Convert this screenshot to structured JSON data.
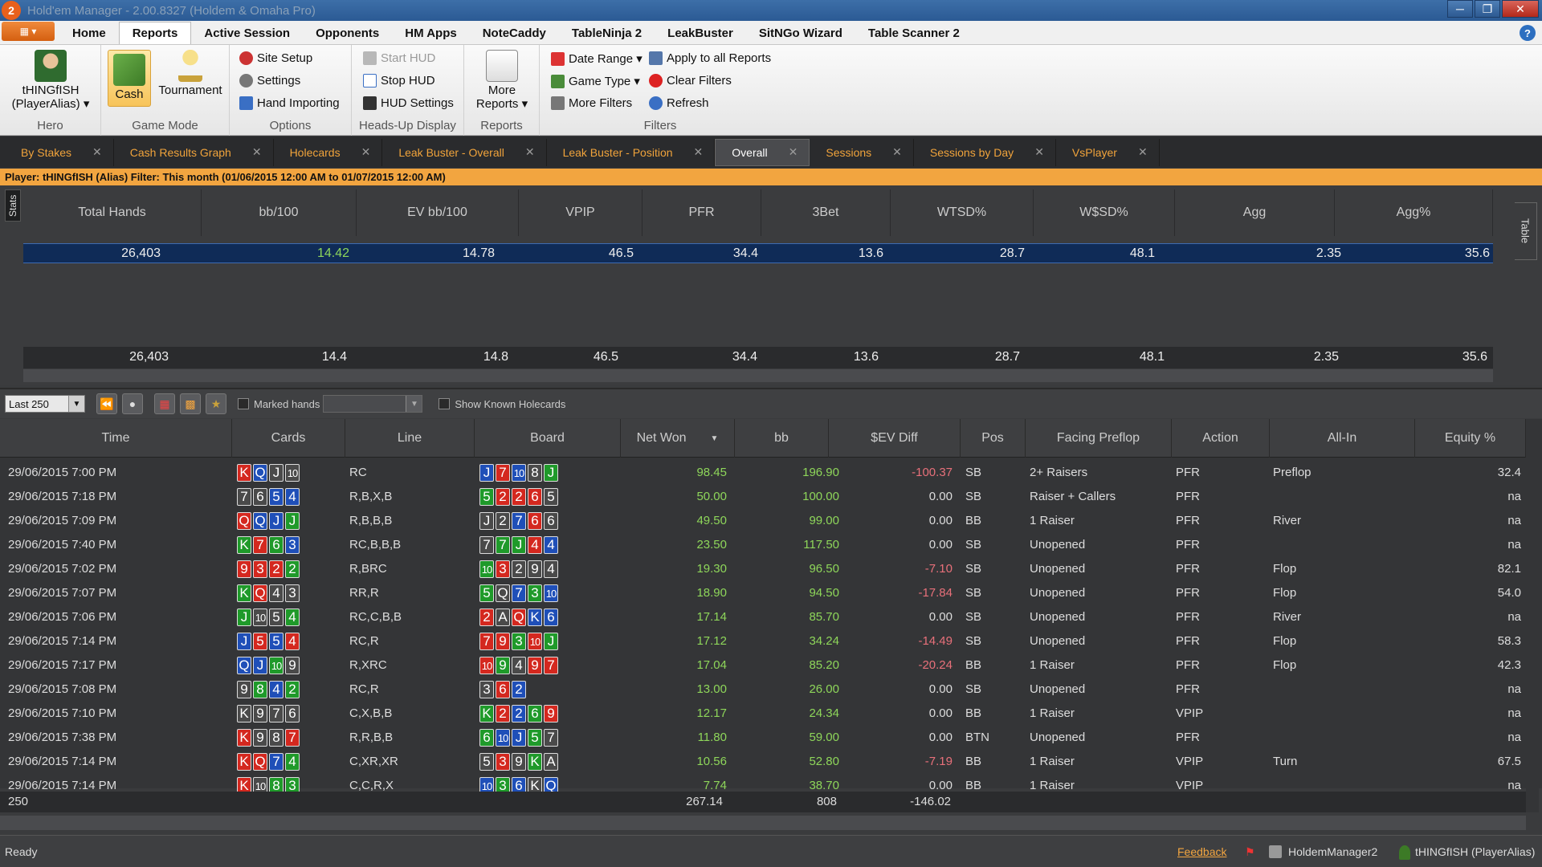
{
  "window": {
    "title": "Hold'em Manager - 2.00.8327 (Holdem & Omaha Pro)",
    "logo": "2",
    "controls": [
      "minimize-icon",
      "maximize-icon",
      "close-icon"
    ]
  },
  "menu": {
    "tabs": [
      "Home",
      "Reports",
      "Active Session",
      "Opponents",
      "HM Apps",
      "NoteCaddy",
      "TableNinja 2",
      "LeakBuster",
      "SitNGo Wizard",
      "Table Scanner 2"
    ],
    "active": "Reports",
    "help": "?"
  },
  "ribbon": {
    "hero": {
      "label": "tHINGfISH (PlayerAlias) ▾",
      "caption": "Hero"
    },
    "game_mode": {
      "cash": "Cash",
      "tournament": "Tournament",
      "caption": "Game Mode"
    },
    "options": {
      "site_setup": "Site Setup",
      "settings": "Settings",
      "hand_importing": "Hand Importing",
      "caption": "Options"
    },
    "hud": {
      "start": "Start HUD",
      "stop": "Stop HUD",
      "settings": "HUD Settings",
      "caption": "Heads-Up Display"
    },
    "reports": {
      "more": "More Reports ▾",
      "caption": "Reports"
    },
    "filters": {
      "date_range": "Date Range ▾",
      "game_type": "Game Type ▾",
      "more_filters": "More Filters",
      "apply_all": "Apply to all Reports",
      "clear": "Clear Filters",
      "refresh": "Refresh",
      "caption": "Filters"
    }
  },
  "doc_tabs": [
    "By Stakes",
    "Cash Results Graph",
    "Holecards",
    "Leak Buster - Overall",
    "Leak Buster - Position",
    "Overall",
    "Sessions",
    "Sessions by Day",
    "VsPlayer"
  ],
  "doc_tabs_active": "Overall",
  "filter_bar": "Player: tHINGfISH (Alias)   Filter: This month (01/06/2015 12:00 AM to 01/07/2015 12:00 AM)",
  "stats": {
    "side_tab": "Stats",
    "table_tab": "Table",
    "headers": [
      "Total Hands",
      "bb/100",
      "EV bb/100",
      "VPIP",
      "PFR",
      "3Bet",
      "WTSD%",
      "W$SD%",
      "Agg",
      "Agg%"
    ],
    "row": [
      "26,403",
      "14.42",
      "14.78",
      "46.5",
      "34.4",
      "13.6",
      "28.7",
      "48.1",
      "2.35",
      "35.6"
    ],
    "totals": [
      "26,403",
      "14.4",
      "14.8",
      "46.5",
      "34.4",
      "13.6",
      "28.7",
      "48.1",
      "2.35",
      "35.6"
    ]
  },
  "hands_toolbar": {
    "last_select": "Last 250",
    "marked_hands": "Marked hands",
    "show_known": "Show Known Holecards"
  },
  "hands": {
    "headers": [
      "Time",
      "Cards",
      "Line",
      "Board",
      "Net Won",
      "bb",
      "$EV Diff",
      "Pos",
      "Facing Preflop",
      "Action",
      "All-In",
      "Equity %"
    ],
    "sort_indicator": "▼",
    "rows": [
      {
        "time": "29/06/2015 7:00 PM",
        "cards": [
          [
            "K",
            "h"
          ],
          [
            "Q",
            "d"
          ],
          [
            "J",
            "s"
          ],
          [
            "10",
            "s"
          ]
        ],
        "line": "RC",
        "board": [
          [
            "J",
            "d"
          ],
          [
            "7",
            "h"
          ],
          [
            "10",
            "d"
          ],
          [
            "8",
            "s"
          ],
          [
            "J",
            "c"
          ]
        ],
        "net": "98.45",
        "bb": "196.90",
        "ev": "-100.37",
        "pos": "SB",
        "facing": "2+ Raisers",
        "action": "PFR",
        "allin": "Preflop",
        "equity": "32.4"
      },
      {
        "time": "29/06/2015 7:18 PM",
        "cards": [
          [
            "7",
            "s"
          ],
          [
            "6",
            "s"
          ],
          [
            "5",
            "d"
          ],
          [
            "4",
            "d"
          ]
        ],
        "line": "R,B,X,B",
        "board": [
          [
            "5",
            "c"
          ],
          [
            "2",
            "h"
          ],
          [
            "2",
            "h"
          ],
          [
            "6",
            "h"
          ],
          [
            "5",
            "s"
          ]
        ],
        "net": "50.00",
        "bb": "100.00",
        "ev": "0.00",
        "pos": "SB",
        "facing": "Raiser + Callers",
        "action": "PFR",
        "allin": "",
        "equity": "na"
      },
      {
        "time": "29/06/2015 7:09 PM",
        "cards": [
          [
            "Q",
            "h"
          ],
          [
            "Q",
            "d"
          ],
          [
            "J",
            "d"
          ],
          [
            "J",
            "c"
          ]
        ],
        "line": "R,B,B,B",
        "board": [
          [
            "J",
            "s"
          ],
          [
            "2",
            "s"
          ],
          [
            "7",
            "d"
          ],
          [
            "6",
            "h"
          ],
          [
            "6",
            "s"
          ]
        ],
        "net": "49.50",
        "bb": "99.00",
        "ev": "0.00",
        "pos": "BB",
        "facing": "1 Raiser",
        "action": "PFR",
        "allin": "River",
        "equity": "na"
      },
      {
        "time": "29/06/2015 7:40 PM",
        "cards": [
          [
            "K",
            "c"
          ],
          [
            "7",
            "h"
          ],
          [
            "6",
            "c"
          ],
          [
            "3",
            "d"
          ]
        ],
        "line": "RC,B,B,B",
        "board": [
          [
            "7",
            "s"
          ],
          [
            "7",
            "c"
          ],
          [
            "J",
            "c"
          ],
          [
            "4",
            "h"
          ],
          [
            "4",
            "d"
          ]
        ],
        "net": "23.50",
        "bb": "117.50",
        "ev": "0.00",
        "pos": "SB",
        "facing": "Unopened",
        "action": "PFR",
        "allin": "",
        "equity": "na"
      },
      {
        "time": "29/06/2015 7:02 PM",
        "cards": [
          [
            "9",
            "h"
          ],
          [
            "3",
            "h"
          ],
          [
            "2",
            "h"
          ],
          [
            "2",
            "c"
          ]
        ],
        "line": "R,BRC",
        "board": [
          [
            "10",
            "c"
          ],
          [
            "3",
            "h"
          ],
          [
            "2",
            "s"
          ],
          [
            "9",
            "s"
          ],
          [
            "4",
            "s"
          ]
        ],
        "net": "19.30",
        "bb": "96.50",
        "ev": "-7.10",
        "pos": "SB",
        "facing": "Unopened",
        "action": "PFR",
        "allin": "Flop",
        "equity": "82.1"
      },
      {
        "time": "29/06/2015 7:07 PM",
        "cards": [
          [
            "K",
            "c"
          ],
          [
            "Q",
            "h"
          ],
          [
            "4",
            "s"
          ],
          [
            "3",
            "s"
          ]
        ],
        "line": "RR,R",
        "board": [
          [
            "5",
            "c"
          ],
          [
            "Q",
            "s"
          ],
          [
            "7",
            "d"
          ],
          [
            "3",
            "c"
          ],
          [
            "10",
            "d"
          ]
        ],
        "net": "18.90",
        "bb": "94.50",
        "ev": "-17.84",
        "pos": "SB",
        "facing": "Unopened",
        "action": "PFR",
        "allin": "Flop",
        "equity": "54.0"
      },
      {
        "time": "29/06/2015 7:06 PM",
        "cards": [
          [
            "J",
            "c"
          ],
          [
            "10",
            "s"
          ],
          [
            "5",
            "s"
          ],
          [
            "4",
            "c"
          ]
        ],
        "line": "RC,C,B,B",
        "board": [
          [
            "2",
            "h"
          ],
          [
            "A",
            "s"
          ],
          [
            "Q",
            "h"
          ],
          [
            "K",
            "d"
          ],
          [
            "6",
            "d"
          ]
        ],
        "net": "17.14",
        "bb": "85.70",
        "ev": "0.00",
        "pos": "SB",
        "facing": "Unopened",
        "action": "PFR",
        "allin": "River",
        "equity": "na"
      },
      {
        "time": "29/06/2015 7:14 PM",
        "cards": [
          [
            "J",
            "d"
          ],
          [
            "5",
            "h"
          ],
          [
            "5",
            "d"
          ],
          [
            "4",
            "h"
          ]
        ],
        "line": "RC,R",
        "board": [
          [
            "7",
            "h"
          ],
          [
            "9",
            "h"
          ],
          [
            "3",
            "c"
          ],
          [
            "10",
            "h"
          ],
          [
            "J",
            "c"
          ]
        ],
        "net": "17.12",
        "bb": "34.24",
        "ev": "-14.49",
        "pos": "SB",
        "facing": "Unopened",
        "action": "PFR",
        "allin": "Flop",
        "equity": "58.3"
      },
      {
        "time": "29/06/2015 7:17 PM",
        "cards": [
          [
            "Q",
            "d"
          ],
          [
            "J",
            "d"
          ],
          [
            "10",
            "c"
          ],
          [
            "9",
            "s"
          ]
        ],
        "line": "R,XRC",
        "board": [
          [
            "10",
            "h"
          ],
          [
            "9",
            "c"
          ],
          [
            "4",
            "s"
          ],
          [
            "9",
            "h"
          ],
          [
            "7",
            "h"
          ]
        ],
        "net": "17.04",
        "bb": "85.20",
        "ev": "-20.24",
        "pos": "BB",
        "facing": "1 Raiser",
        "action": "PFR",
        "allin": "Flop",
        "equity": "42.3"
      },
      {
        "time": "29/06/2015 7:08 PM",
        "cards": [
          [
            "9",
            "s"
          ],
          [
            "8",
            "c"
          ],
          [
            "4",
            "d"
          ],
          [
            "2",
            "c"
          ]
        ],
        "line": "RC,R",
        "board": [
          [
            "3",
            "s"
          ],
          [
            "6",
            "h"
          ],
          [
            "2",
            "d"
          ]
        ],
        "net": "13.00",
        "bb": "26.00",
        "ev": "0.00",
        "pos": "SB",
        "facing": "Unopened",
        "action": "PFR",
        "allin": "",
        "equity": "na"
      },
      {
        "time": "29/06/2015 7:10 PM",
        "cards": [
          [
            "K",
            "s"
          ],
          [
            "9",
            "s"
          ],
          [
            "7",
            "s"
          ],
          [
            "6",
            "s"
          ]
        ],
        "line": "C,X,B,B",
        "board": [
          [
            "K",
            "c"
          ],
          [
            "2",
            "h"
          ],
          [
            "2",
            "d"
          ],
          [
            "6",
            "c"
          ],
          [
            "9",
            "h"
          ]
        ],
        "net": "12.17",
        "bb": "24.34",
        "ev": "0.00",
        "pos": "BB",
        "facing": "1 Raiser",
        "action": "VPIP",
        "allin": "",
        "equity": "na"
      },
      {
        "time": "29/06/2015 7:38 PM",
        "cards": [
          [
            "K",
            "h"
          ],
          [
            "9",
            "s"
          ],
          [
            "8",
            "s"
          ],
          [
            "7",
            "h"
          ]
        ],
        "line": "R,R,B,B",
        "board": [
          [
            "6",
            "c"
          ],
          [
            "10",
            "d"
          ],
          [
            "J",
            "d"
          ],
          [
            "5",
            "c"
          ],
          [
            "7",
            "s"
          ]
        ],
        "net": "11.80",
        "bb": "59.00",
        "ev": "0.00",
        "pos": "BTN",
        "facing": "Unopened",
        "action": "PFR",
        "allin": "",
        "equity": "na"
      },
      {
        "time": "29/06/2015 7:14 PM",
        "cards": [
          [
            "K",
            "h"
          ],
          [
            "Q",
            "h"
          ],
          [
            "7",
            "d"
          ],
          [
            "4",
            "c"
          ]
        ],
        "line": "C,XR,XR",
        "board": [
          [
            "5",
            "s"
          ],
          [
            "3",
            "h"
          ],
          [
            "9",
            "s"
          ],
          [
            "K",
            "c"
          ],
          [
            "A",
            "s"
          ]
        ],
        "net": "10.56",
        "bb": "52.80",
        "ev": "-7.19",
        "pos": "BB",
        "facing": "1 Raiser",
        "action": "VPIP",
        "allin": "Turn",
        "equity": "67.5"
      },
      {
        "time": "29/06/2015 7:14 PM",
        "cards": [
          [
            "K",
            "h"
          ],
          [
            "10",
            "s"
          ],
          [
            "8",
            "c"
          ],
          [
            "3",
            "c"
          ]
        ],
        "line": "C,C,R,X",
        "board": [
          [
            "10",
            "d"
          ],
          [
            "3",
            "c"
          ],
          [
            "6",
            "d"
          ],
          [
            "K",
            "s"
          ],
          [
            "Q",
            "d"
          ]
        ],
        "net": "7.74",
        "bb": "38.70",
        "ev": "0.00",
        "pos": "BB",
        "facing": "1 Raiser",
        "action": "VPIP",
        "allin": "",
        "equity": "na"
      }
    ],
    "totals": {
      "count": "250",
      "net": "267.14",
      "bb": "808",
      "ev": "-146.02"
    }
  },
  "status": {
    "ready": "Ready",
    "feedback": "Feedback",
    "database": "HoldemManager2",
    "player": "tHINGfISH (PlayerAlias)"
  },
  "colors": {
    "accent_orange": "#f2a540",
    "positive": "#8ed65a",
    "negative": "#e8707a",
    "selected_row": "#0f2b57",
    "suit_spades": "#4a4a4a",
    "suit_hearts": "#d4281f",
    "suit_diamonds": "#1f4fb8",
    "suit_clubs": "#1f9a2a"
  }
}
